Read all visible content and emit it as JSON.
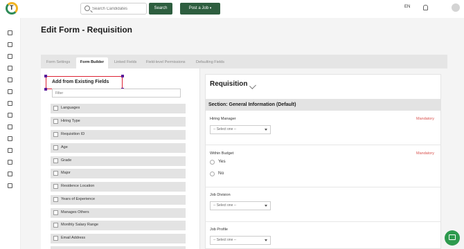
{
  "header": {
    "search_placeholder": "Search Candidates",
    "search_button": "Search",
    "post_job_button": "Post a Job",
    "language": "EN"
  },
  "page": {
    "title": "Edit Form - Requisition"
  },
  "tabs": [
    "Form Settings",
    "Form Builder",
    "Linked Fields",
    "Field-level Permissions",
    "Defaulting Fields"
  ],
  "left_panel": {
    "title": "Add from Existing Fields",
    "filter_placeholder": "Filter",
    "fields": [
      "Languages",
      "Hiring Type",
      "Requisition ID",
      "Age",
      "Grade",
      "Major",
      "Residence Location",
      "Years of Experience",
      "Manages Others",
      "Monthly Salary Range",
      "Email Address"
    ]
  },
  "form": {
    "title": "Requisition",
    "section_title": "Section: General Information (Default)",
    "mandatory_label": "Mandatory",
    "hiring_manager": {
      "label": "Hiring Manager",
      "select": "-- Select one --"
    },
    "within_budget": {
      "label": "Within Budget",
      "yes": "Yes",
      "no": "No"
    },
    "job_division": {
      "label": "Job Division",
      "select": "-- Select one --"
    },
    "job_profile": {
      "label": "Job Profile",
      "select": "-- Select one --"
    }
  },
  "icons": [
    "search-icon",
    "bell-icon",
    "pencil-icon",
    "chat-icon"
  ]
}
